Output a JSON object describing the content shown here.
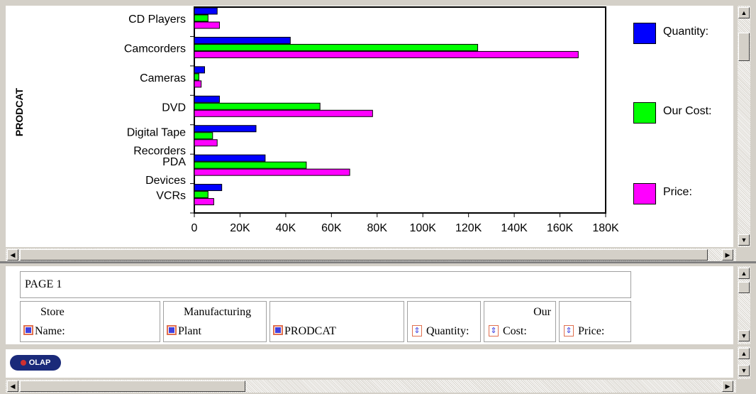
{
  "chart_data": {
    "type": "bar",
    "orientation": "horizontal",
    "ylabel": "PRODCAT",
    "xlabel": "",
    "categories": [
      "CD Players",
      "Camcorders",
      "Cameras",
      "DVD",
      "Digital Tape Recorders",
      "PDA Devices",
      "VCRs"
    ],
    "category_label_lines": [
      [
        "CD Players"
      ],
      [
        "Camcorders"
      ],
      [
        "Cameras"
      ],
      [
        "DVD"
      ],
      [
        "Digital Tape",
        "Recorders"
      ],
      [
        "PDA",
        "Devices"
      ],
      [
        "VCRs"
      ]
    ],
    "series": [
      {
        "name": "Quantity:",
        "color": "#0000ff",
        "values": [
          10000,
          42000,
          4500,
          11000,
          27000,
          31000,
          12000
        ]
      },
      {
        "name": "Our Cost:",
        "color": "#00ff00",
        "values": [
          6000,
          124000,
          2000,
          55000,
          8000,
          49000,
          6000
        ]
      },
      {
        "name": "Price:",
        "color": "#ff00ff",
        "values": [
          11000,
          168000,
          3000,
          78000,
          10000,
          68000,
          8500
        ]
      }
    ],
    "xlim": [
      0,
      180000
    ],
    "xticks": [
      0,
      20000,
      40000,
      60000,
      80000,
      100000,
      120000,
      140000,
      160000,
      180000
    ],
    "xtick_labels": [
      "0",
      "20K",
      "40K",
      "60K",
      "80K",
      "100K",
      "120K",
      "140K",
      "160K",
      "180K"
    ],
    "legend_position": "right",
    "grid": false
  },
  "pivot": {
    "page_label": "PAGE 1",
    "columns": [
      {
        "line1": "Store",
        "line2": "Name:",
        "icon": "dimension-icon"
      },
      {
        "line1": "Manufacturing",
        "line2": "Plant",
        "icon": "dimension-icon"
      },
      {
        "line1": "",
        "line2": "PRODCAT",
        "icon": "dimension-icon"
      },
      {
        "line1": "",
        "line2": "Quantity:",
        "icon": "sort-icon"
      },
      {
        "line1": "Our",
        "line2": "Cost:",
        "icon": "sort-icon"
      },
      {
        "line1": "",
        "line2": "Price:",
        "icon": "sort-icon"
      }
    ]
  },
  "toolbar": {
    "olap_label": "OLAP"
  },
  "scroll": {
    "up": "▲",
    "down": "▼",
    "left": "◀",
    "right": "▶"
  }
}
